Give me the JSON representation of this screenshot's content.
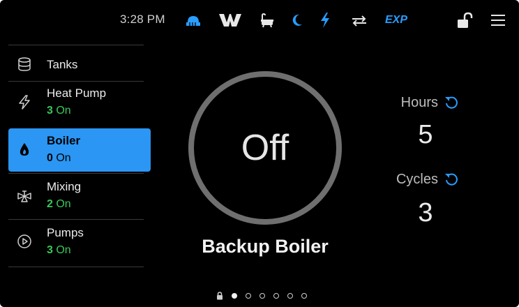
{
  "status_bar": {
    "time": "3:28 PM",
    "exp_label": "EXP",
    "icons": [
      "floor-heat-icon",
      "dhw-w-icon",
      "bath-icon",
      "night-mode-icon",
      "power-icon",
      "exchange-icon",
      "unlock-icon",
      "menu-icon"
    ],
    "accent_color": "#2a9dff"
  },
  "sidebar": {
    "items": [
      {
        "label": "Tanks",
        "icon": "tank-icon"
      },
      {
        "label": "Heat Pump",
        "count": "3",
        "state": "On",
        "icon": "heat-pump-icon"
      },
      {
        "label": "Boiler",
        "count": "0",
        "state": "On",
        "icon": "flame-icon",
        "selected": true
      },
      {
        "label": "Mixing",
        "count": "2",
        "state": "On",
        "icon": "mixing-valve-icon"
      },
      {
        "label": "Pumps",
        "count": "3",
        "state": "On",
        "icon": "pump-icon"
      }
    ],
    "selected_color": "#2b96f3",
    "on_color": "#38c85a"
  },
  "main": {
    "status": "Off",
    "device_name": "Backup Boiler"
  },
  "stats": {
    "hours_label": "Hours",
    "hours_value": "5",
    "cycles_label": "Cycles",
    "cycles_value": "3"
  },
  "pager": {
    "total_dots": 6,
    "active_index": 0
  }
}
